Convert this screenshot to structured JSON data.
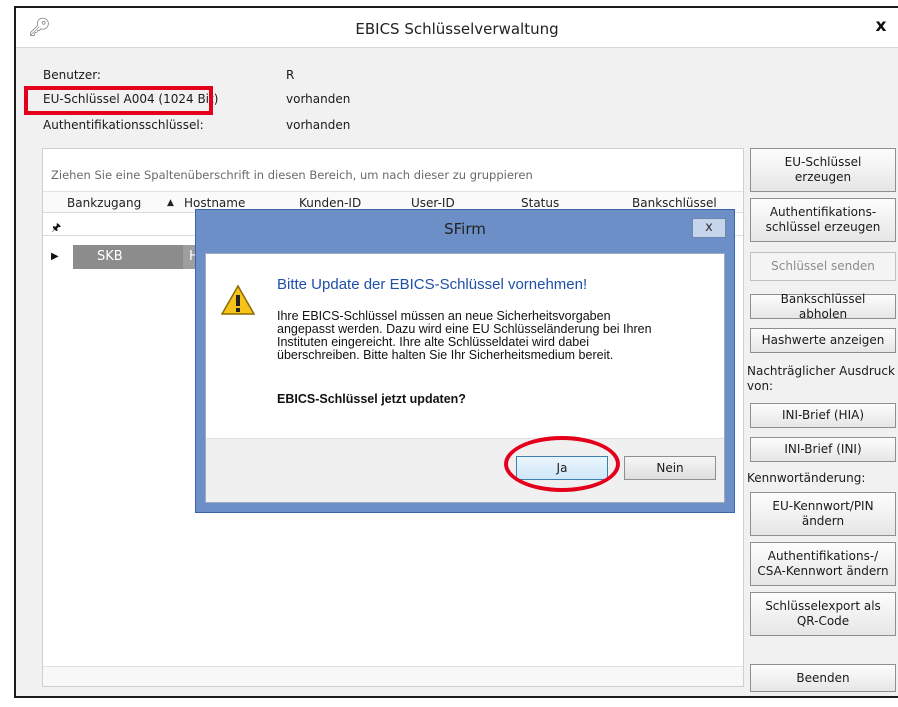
{
  "window": {
    "title": "EBICS Schlüsselverwaltung",
    "close_label": "x",
    "app_icon": "key-icon"
  },
  "info": {
    "user_label": "Benutzer:",
    "user_value": "R",
    "eu_key_label": "EU-Schlüssel A004 (1024 Bit)",
    "eu_key_value": "vorhanden",
    "auth_key_label": "Authentifikationsschlüssel:",
    "auth_key_value": "vorhanden"
  },
  "grid": {
    "group_hint": "Ziehen Sie eine Spaltenüberschrift in diesen Bereich, um nach dieser zu gruppieren",
    "columns": [
      "Bankzugang",
      "Hostname",
      "Kunden-ID",
      "User-ID",
      "Status",
      "Bankschlüssel"
    ],
    "sort_indicator": "▲",
    "filter_icon": "pin-icon",
    "rows": [
      {
        "bankzugang": "SKB",
        "hostname": "H"
      }
    ]
  },
  "buttons": {
    "eu_key_create": "EU-Schlüssel erzeugen",
    "auth_key_create": "Authentifikations-schlüssel erzeugen",
    "key_send": "Schlüssel senden",
    "bank_key_fetch": "Bankschlüssel abholen",
    "hash_show": "Hashwerte anzeigen",
    "later_print_label": "Nachträglicher Ausdruck von:",
    "ini_hia": "INI-Brief (HIA)",
    "ini_ini": "INI-Brief (INI)",
    "password_change_label": "Kennwortänderung:",
    "eu_pw_change": "EU-Kennwort/PIN ändern",
    "auth_pw_change": "Authentifikations-/ CSA-Kennwort ändern",
    "export_qr": "Schlüsselexport als QR-Code",
    "quit": "Beenden"
  },
  "dialog": {
    "title": "SFirm",
    "close_label": "x",
    "heading": "Bitte Update der EBICS-Schlüssel vornehmen!",
    "message_lines": [
      "Ihre EBICS-Schlüssel müssen an neue Sicherheitsvorgaben",
      "angepasst werden. Dazu wird eine EU Schlüsseländerung bei Ihren",
      "Instituten eingereicht. Ihre alte Schlüsseldatei wird dabei",
      "überschreiben. Bitte halten Sie Ihr Sicherheitsmedium bereit."
    ],
    "question": "EBICS-Schlüssel jetzt updaten?",
    "yes": "Ja",
    "no": "Nein"
  },
  "colors": {
    "highlight_red": "#e4001b",
    "dialog_frame": "#6c8fc7",
    "heading_blue": "#1f4fa8",
    "selected_row": "#8c8c8c"
  }
}
